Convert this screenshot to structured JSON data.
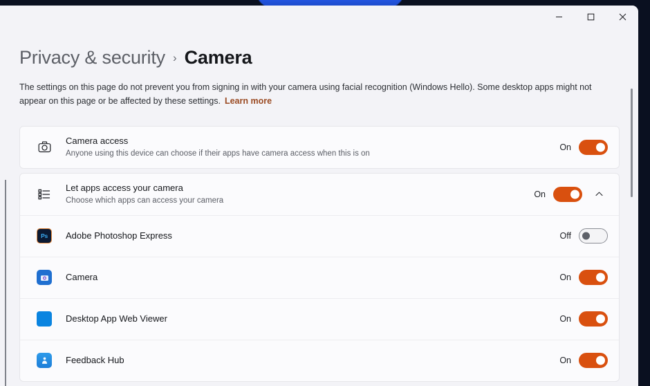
{
  "window": {
    "controls": [
      {
        "name": "minimize-button",
        "label": "Minimize",
        "glyph": "minimize"
      },
      {
        "name": "maximize-button",
        "label": "Maximize",
        "glyph": "maximize"
      },
      {
        "name": "close-button",
        "label": "Close",
        "glyph": "close"
      }
    ]
  },
  "breadcrumb": {
    "parent": "Privacy & security",
    "separator": "›",
    "current": "Camera"
  },
  "description": {
    "text": "The settings on this page do not prevent you from signing in with your camera using facial recognition (Windows Hello). Some desktop apps might not appear on this page or be affected by these settings.",
    "link_label": "Learn more"
  },
  "cards": {
    "camera_access": {
      "icon": "camera-icon",
      "title": "Camera access",
      "subtitle": "Anyone using this device can choose if their apps have camera access when this is on",
      "state_label": "On",
      "state": "on"
    },
    "let_apps": {
      "icon": "list-icon",
      "title": "Let apps access your camera",
      "subtitle": "Choose which apps can access your camera",
      "state_label": "On",
      "state": "on",
      "expanded": true,
      "chevron": "chevron-up-icon"
    },
    "apps": [
      {
        "name": "Adobe Photoshop Express",
        "icon": "photoshop-express-icon",
        "tile": "tile-ps",
        "tile_text": "Ps",
        "state_label": "Off",
        "state": "off"
      },
      {
        "name": "Camera",
        "icon": "camera-app-icon",
        "tile": "tile-camera",
        "tile_text": "",
        "state_label": "On",
        "state": "on"
      },
      {
        "name": "Desktop App Web Viewer",
        "icon": "desktop-app-web-viewer-icon",
        "tile": "tile-plain",
        "tile_text": "",
        "state_label": "On",
        "state": "on"
      },
      {
        "name": "Feedback Hub",
        "icon": "feedback-hub-icon",
        "tile": "tile-feedback",
        "tile_text": "",
        "state_label": "On",
        "state": "on"
      }
    ]
  },
  "colors": {
    "accent_toggle_on": "#d9500f",
    "link": "#9a4a22",
    "page_background": "#f3f3f7",
    "card_background": "#fbfbfd"
  }
}
